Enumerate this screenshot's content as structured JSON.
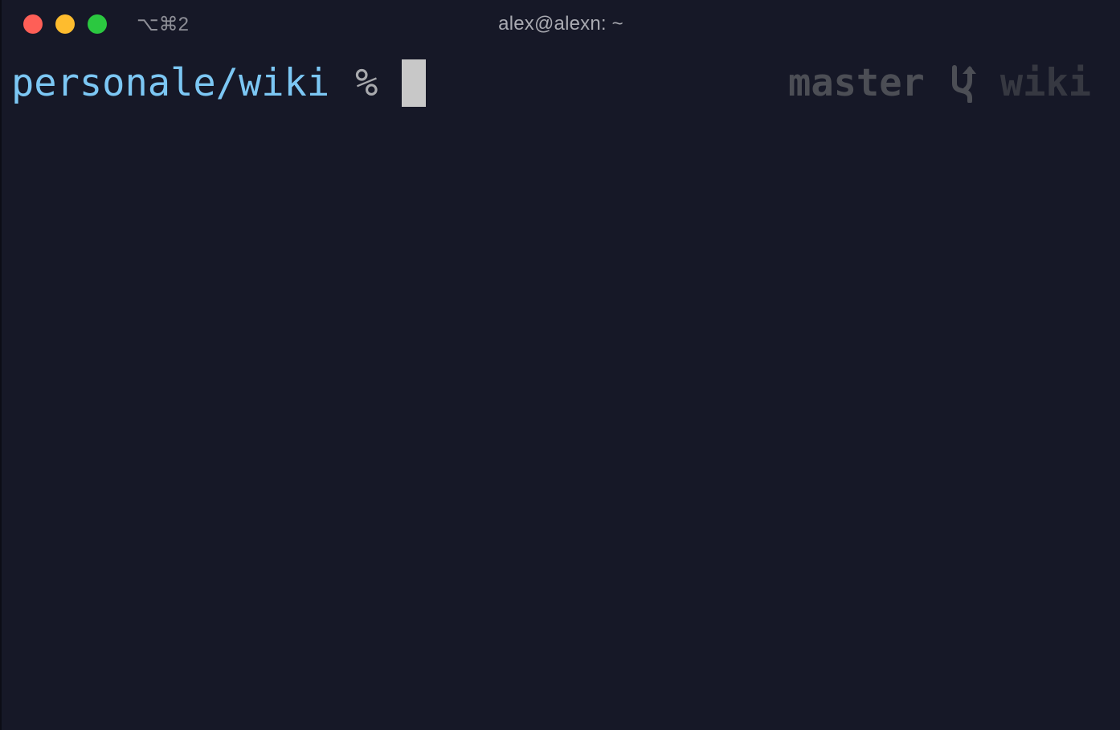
{
  "window": {
    "shortcut": "⌥⌘2",
    "title": "alex@alexn: ~",
    "traffic_lights": {
      "close_color": "#fe5f57",
      "minimize_color": "#febc2e",
      "zoom_color": "#2bc840"
    }
  },
  "terminal": {
    "background": "#161827",
    "prompt": {
      "path": "personale/wiki",
      "symbol": "%",
      "path_color": "#7cc7f4",
      "cursor_color": "#c8c8c8"
    },
    "right_prompt": {
      "branch": "master",
      "branch_icon": "git-branch-icon",
      "repo": "wiki"
    }
  }
}
